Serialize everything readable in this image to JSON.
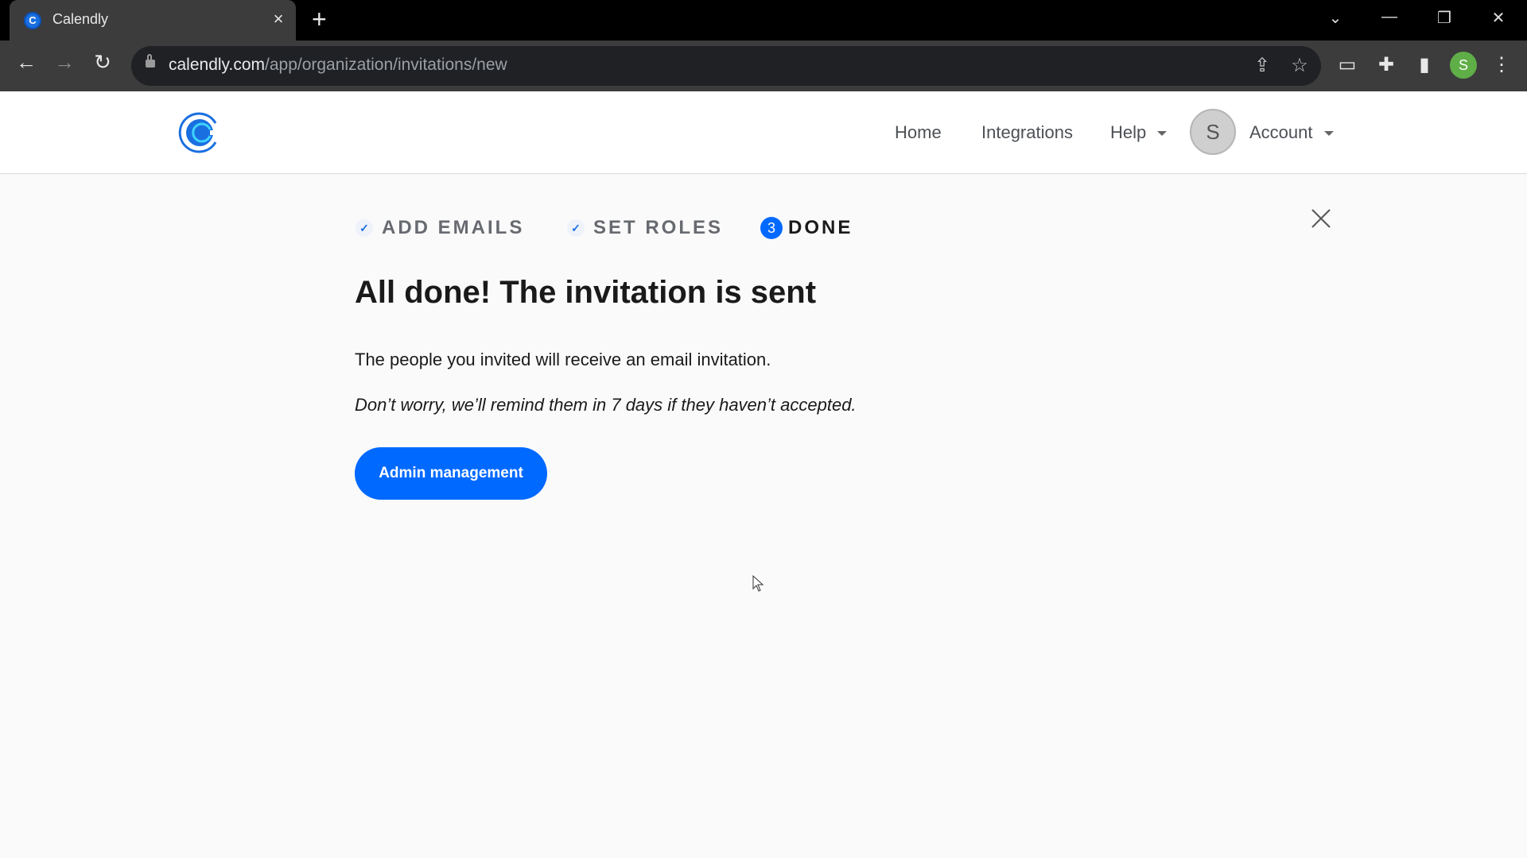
{
  "browser": {
    "tab": {
      "title": "Calendly",
      "favicon_letter": "C"
    },
    "new_tab_glyph": "+",
    "url_host": "calendly.com",
    "url_path": "/app/organization/invitations/new",
    "profile_initial": "S",
    "window_controls": {
      "tab_search": "⌄",
      "minimize": "—",
      "restore": "❐",
      "close": "✕"
    },
    "nav": {
      "back": "←",
      "forward": "→",
      "reload": "↻"
    },
    "toolbar_icons": {
      "share": "⇪",
      "bookmark": "☆",
      "extension_alert": "▭",
      "extensions": "✚",
      "side_panel": "▮",
      "menu": "⋮"
    }
  },
  "header": {
    "nav": [
      {
        "label": "Home"
      },
      {
        "label": "Integrations"
      },
      {
        "label": "Help",
        "has_dropdown": true
      },
      {
        "label": "Account",
        "has_dropdown": true
      }
    ],
    "avatar_initial": "S"
  },
  "steps": [
    {
      "label": "ADD EMAILS",
      "status": "complete",
      "icon": "✓"
    },
    {
      "label": "SET ROLES",
      "status": "complete",
      "icon": "✓"
    },
    {
      "label": "DONE",
      "status": "current",
      "number": "3"
    }
  ],
  "main": {
    "heading": "All done! The invitation is sent",
    "paragraph1": "The people you invited will receive an email invitation.",
    "paragraph2": "Don’t worry, we’ll remind them in 7 days if they haven’t accepted.",
    "button_label": "Admin management"
  },
  "colors": {
    "brand_blue": "#0069ff",
    "text_dark": "#1a1a1a",
    "text_muted": "#676a70"
  }
}
